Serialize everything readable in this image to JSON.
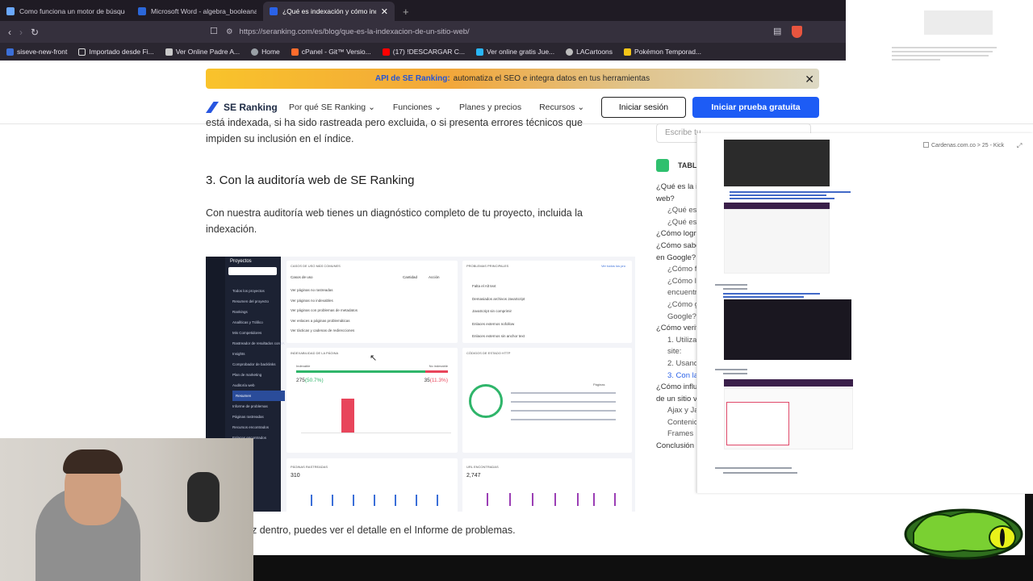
{
  "browser": {
    "tabs": [
      {
        "title": "Como funciona un motor de búsque..."
      },
      {
        "title": "Microsoft Word - algebra_booleana..."
      },
      {
        "title": "¿Qué es indexación y cómo inde..."
      }
    ],
    "url": "https://seranking.com/es/blog/que-es-la-indexacion-de-un-sitio-web/",
    "bookmarks": [
      {
        "label": "siseve-new-front"
      },
      {
        "label": "Importado desde Fi..."
      },
      {
        "label": "Ver Online Padre A..."
      },
      {
        "label": "Home"
      },
      {
        "label": "cPanel - Git™ Versio..."
      },
      {
        "label": "(17) !DESCARGAR C..."
      },
      {
        "label": "Ver online gratis Jue..."
      },
      {
        "label": "LACartoons"
      },
      {
        "label": "Pokémon Temporad..."
      }
    ]
  },
  "banner": {
    "highlight": "API de SE Ranking:",
    "text": "automatiza el SEO e integra datos en tus herramientas"
  },
  "nav": {
    "logo": "SE Ranking",
    "items": [
      "Por qué SE Ranking",
      "Funciones",
      "Planes y precios",
      "Recursos"
    ],
    "login": "Iniciar sesión",
    "trial": "Iniciar prueba gratuita"
  },
  "article": {
    "para1_line1": "está indexada, si ha sido rastreada pero excluida, o si presenta errores técnicos que",
    "para1_line2": "impiden su inclusión en el índice.",
    "heading": "3. Con la auditoría web de SE Ranking",
    "para2_line1": "Con nuestra auditoría web tienes un diagnóstico completo de tu proyecto, incluida la",
    "para2_line2": "indexación.",
    "caption": "z dentro, puedes ver el detalle en el Informe de problemas."
  },
  "screenshot": {
    "side_title": "Proyectos",
    "menu": [
      "Todos los proyectos",
      "Resumen del proyecto",
      "Rankings",
      "Analíticas y Tráfico",
      "Mis Competidores",
      "Rastreador de resultados con IA",
      "Insights",
      "Comprobador de backlinks",
      "Plan de marketing",
      "Auditoría web",
      "Resumen",
      "Informe de problemas",
      "Páginas rastreadas",
      "Recursos encontrados",
      "Enlaces encontrados"
    ],
    "panel1_title": "CASOS DE USO MÁS COMUNES",
    "panel1_cols": [
      "Casos de uso",
      "Cantidad",
      "Acción"
    ],
    "panel1_rows": [
      "Ver páginas no rastreadas",
      "Ver páginas no indexables",
      "Ver páginas con problemas de metadatos",
      "Ver enlaces a páginas problemáticas",
      "Ver tácticas y cadenas de redirecciones"
    ],
    "panel2_title": "PROBLEMAS PRINCIPALES",
    "panel2_link": "Ver todos los pro",
    "panel2_rows": [
      "Falta el Alt text",
      "Demasiados archivos JavaScript",
      "JavaScript sin comprimir",
      "Enlaces externos nofollow",
      "Enlaces externos sin anchor text"
    ],
    "panel3_title": "INDEXABILIDAD DE LA PÁGINA",
    "panel3_indexable": "Indexable",
    "panel3_noindex": "No indexable",
    "panel3_left_value": "275",
    "panel3_left_pct": "(50.7%)",
    "panel3_right_value": "35",
    "panel3_right_pct": "(11.3%)",
    "panel4_title": "CÓDIGOS DE ESTADO HTTP",
    "panel4_col": "Páginas",
    "panel5_title": "PÁGINAS RASTREADAS",
    "panel5_value": "310",
    "panel6_title": "URL ENCONTRADAS",
    "panel6_value": "2,747"
  },
  "sidebar": {
    "search_placeholder": "Escribe tu...",
    "toc_title": "TABL",
    "toc": [
      "¿Qué es la i",
      "web?",
      "¿Qué es",
      "¿Qué es",
      "¿Cómo logra",
      "¿Cómo sabe",
      "en Google?",
      "¿Cómo fu",
      "¿Cómo lo",
      "encuentr",
      "¿Cómo g",
      "Google?",
      "¿Cómo verif",
      "1. Utiliza",
      "site:",
      "2. Usand",
      "3. Con la",
      "¿Cómo influ",
      "de un sitio v",
      "Ajax y Ja",
      "Contenic",
      "Frames",
      "Conclusión"
    ]
  },
  "overlay": {
    "title": "Cardenas.com.co > 25 - Kick"
  },
  "colors": {
    "accent": "#1d5cf5",
    "banner_start": "#f9c32b",
    "chrome_dark": "#1f1b24"
  }
}
